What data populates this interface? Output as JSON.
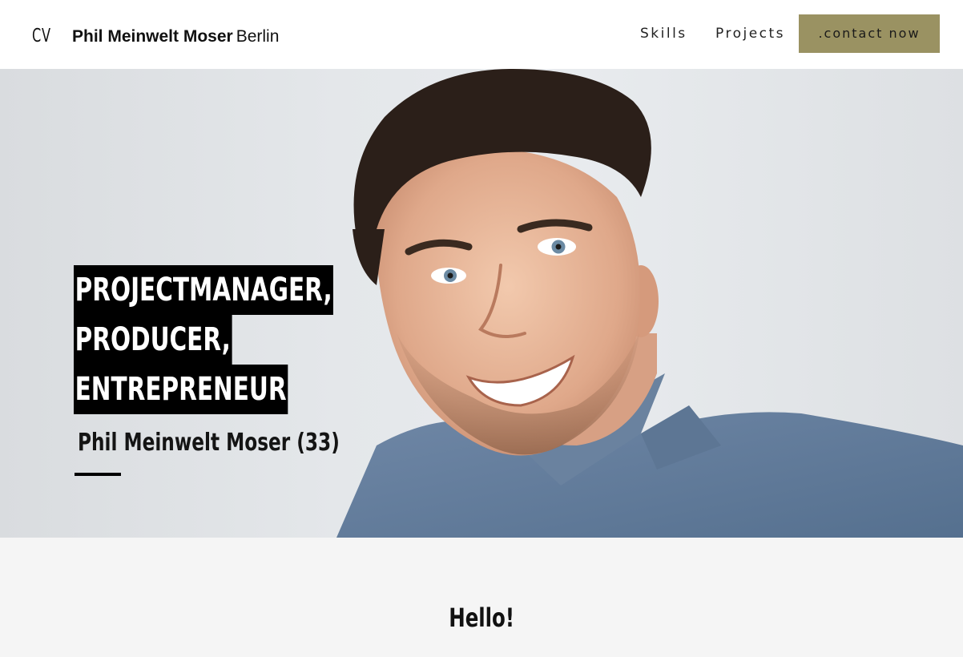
{
  "header": {
    "logo": "CV",
    "brand_name": "Phil Meinwelt Moser",
    "brand_city": "Berlin",
    "nav": {
      "skills": "Skills",
      "projects": "Projects"
    },
    "contact_label": ".contact now"
  },
  "hero": {
    "title_lines": [
      " PROJECTMANAGER,",
      "PRODUCER,",
      "ENTREPRENEUR "
    ],
    "subtitle": "Phil Meinwelt Moser (33)"
  },
  "hello": {
    "title": "Hello!"
  },
  "colors": {
    "accent": "#9a9262",
    "header_bg": "#ffffff",
    "section_bg": "#f5f5f5",
    "text": "#111111"
  }
}
